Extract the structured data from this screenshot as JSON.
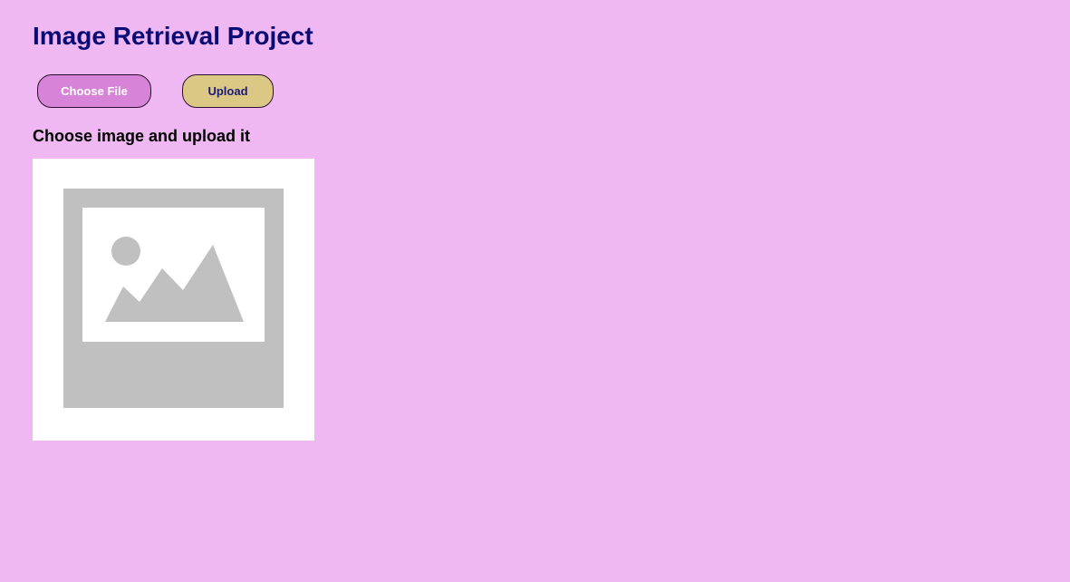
{
  "page": {
    "title": "Image Retrieval Project",
    "instruction": "Choose image and upload it"
  },
  "controls": {
    "choose_file_label": "Choose File",
    "upload_label": "Upload"
  },
  "preview": {
    "icon": "image-placeholder-icon"
  },
  "colors": {
    "background": "#efb8f3",
    "title": "#0b0b75",
    "choose_button": "#d783d7",
    "upload_button": "#dcc885",
    "placeholder_gray": "#c0c0c0"
  }
}
